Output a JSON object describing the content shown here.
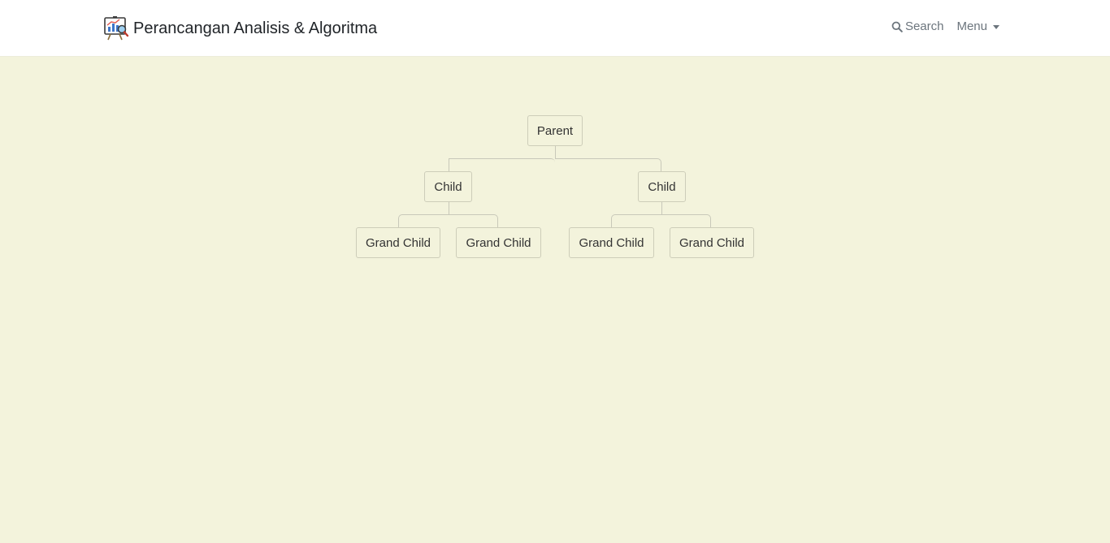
{
  "header": {
    "site_title": "Perancangan Analisis & Algoritma",
    "logo_icon": "presentation-board-chart-icon",
    "search_label": "Search",
    "menu_label": "Menu"
  },
  "tree": {
    "root": {
      "label": "Parent",
      "children": [
        {
          "label": "Child",
          "children": [
            {
              "label": "Grand Child"
            },
            {
              "label": "Grand Child"
            }
          ]
        },
        {
          "label": "Child",
          "children": [
            {
              "label": "Grand Child"
            },
            {
              "label": "Grand Child"
            }
          ]
        }
      ]
    }
  },
  "colors": {
    "page_background": "#f3f3dc",
    "navbar_background": "#ffffff",
    "node_border": "#cdcdb9",
    "connector": "#c8c8b9"
  }
}
